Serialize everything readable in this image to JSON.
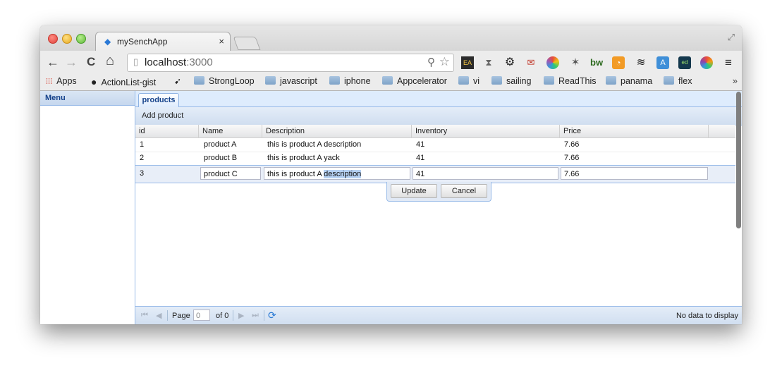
{
  "browser": {
    "tab_title": "mySenchApp",
    "tab_icon": "sencha-logo",
    "tab_close": "×",
    "url_host": "localhost",
    "url_port": ":3000",
    "nav": {
      "back": "←",
      "forward": "→",
      "reload": "C",
      "home": "⌂"
    },
    "bookmarks": [
      "Apps",
      "ActionList-gist",
      "StrongLoop",
      "javascript",
      "iphone",
      "Appcelerator",
      "vi",
      "sailing",
      "ReadThis",
      "panama",
      "flex"
    ],
    "bookmarks_overflow": "»",
    "extension_icons": [
      "pocket-icon",
      "hourglass-icon",
      "gear-icon",
      "envelope-icon",
      "color-wheel-icon",
      "puzzle-icon",
      "bw-icon",
      "rss-icon",
      "layers-icon",
      "translate-icon",
      "editor-icon",
      "ring-icon",
      "menu-icon"
    ],
    "extension_bw_label": "bw"
  },
  "app": {
    "menu_title": "Menu",
    "tab_label": "products",
    "add_product_label": "Add product",
    "columns": [
      "id",
      "Name",
      "Description",
      "Inventory",
      "Price"
    ],
    "rows": [
      {
        "id": "1",
        "name": "product A",
        "description": "this is product A description",
        "inventory": "41",
        "price": "7.66"
      },
      {
        "id": "2",
        "name": "product B",
        "description": "this is product A yack",
        "inventory": "41",
        "price": "7.66"
      }
    ],
    "edit_row": {
      "id": "3",
      "name": "product C",
      "description_unselected": "this is product A ",
      "description_selected": "description",
      "inventory": "41",
      "price": "7.66"
    },
    "update_label": "Update",
    "cancel_label": "Cancel",
    "pager": {
      "page_label": "Page",
      "page_value": "0",
      "of_label": "of 0",
      "status": "No data to display"
    }
  },
  "colors": {
    "accent": "#15428b",
    "panel_border": "#99bbe8",
    "selection": "#b6d1f3"
  }
}
